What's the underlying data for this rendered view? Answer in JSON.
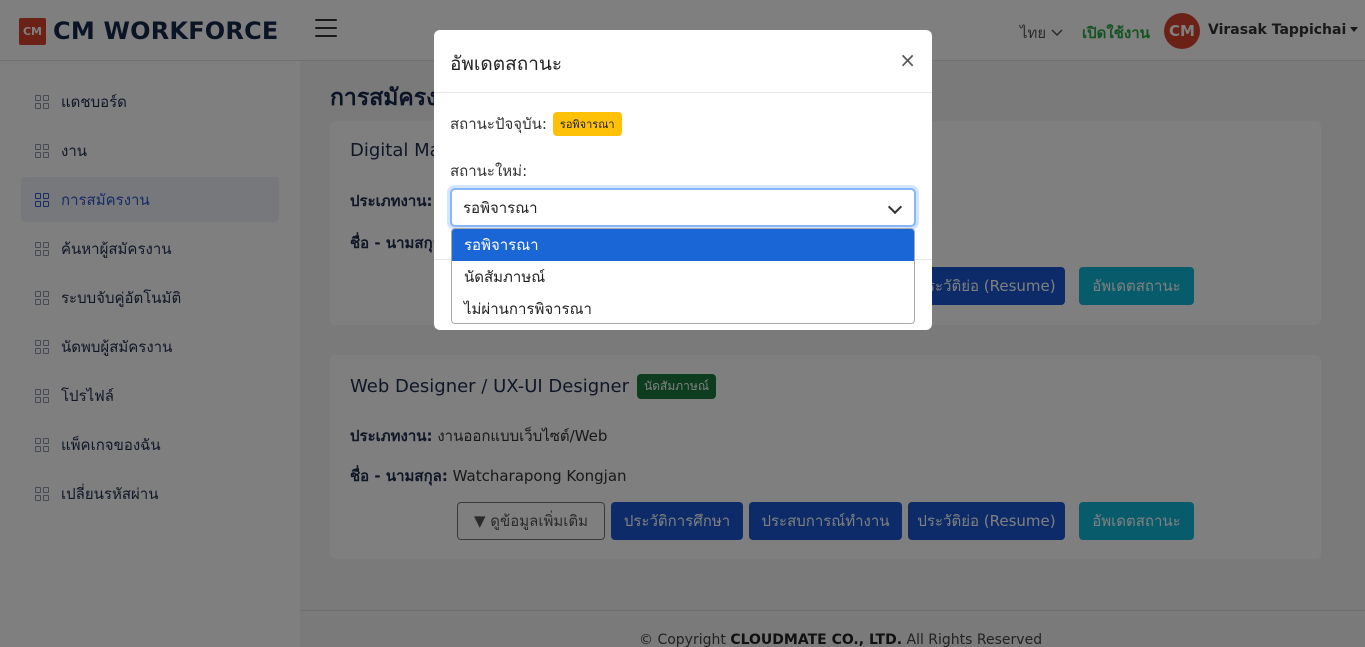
{
  "header": {
    "logo_mark": "CM",
    "logo_text": "CM WORKFORCE",
    "language": "ไทย",
    "activate": "เปิดใช้งาน",
    "avatar_text": "CM",
    "user_name": "Virasak Tappichai"
  },
  "sidebar": {
    "items": [
      {
        "label": "แดชบอร์ด"
      },
      {
        "label": "งาน"
      },
      {
        "label": "การสมัครงาน"
      },
      {
        "label": "ค้นหาผู้สมัครงาน"
      },
      {
        "label": "ระบบจับคู่อัตโนมัติ"
      },
      {
        "label": "นัดพบผู้สมัครงาน"
      },
      {
        "label": "โปรไฟล์"
      },
      {
        "label": "แพ็คเกจของฉัน"
      },
      {
        "label": "เปลี่ยนรหัสผ่าน"
      }
    ]
  },
  "main": {
    "page_title": "การสมัครงาน",
    "cards": [
      {
        "title": "Digital Ma",
        "type_label": "ประเภทงาน:",
        "name_label": "ชื่อ - นามสกุล:",
        "buttons": {
          "resume": "ประวัติย่อ (Resume)",
          "update": "อัพเดตสถานะ"
        }
      },
      {
        "title": "Web Designer / UX-UI Designer",
        "badge": "นัดสัมภาษณ์",
        "type_label": "ประเภทงาน:",
        "type_value": "งานออกแบบเว็บไซต์/Web",
        "name_label": "ชื่อ - นามสกุล:",
        "name_value": "Watcharapong Kongjan",
        "buttons": {
          "more": "▼ ดูข้อมูลเพิ่มเติม",
          "education": "ประวัติการศึกษา",
          "experience": "ประสบการณ์ทำงาน",
          "resume": "ประวัติย่อ (Resume)",
          "update": "อัพเดตสถานะ"
        }
      }
    ],
    "footer_prefix": "© Copyright ",
    "footer_company": "CLOUDMATE CO., LTD.",
    "footer_suffix": " All Rights Reserved"
  },
  "modal": {
    "title": "อัพเดตสถานะ",
    "close": "×",
    "current_label": "สถานะปัจจุบัน:",
    "current_badge": "รอพิจารณา",
    "new_label": "สถานะใหม่:",
    "select_value": "รอพิจารณา",
    "options": [
      "รอพิจารณา",
      "นัดสัมภาษณ์",
      "ไม่ผ่านการพิจารณา"
    ]
  }
}
